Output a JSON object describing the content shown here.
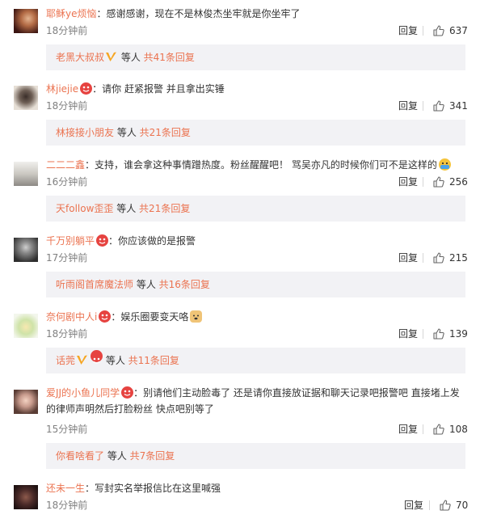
{
  "comments": [
    {
      "username": "耶稣ye烦恼",
      "separator": "：",
      "text": "感谢感谢，现在不是林俊杰坐牢就是你坐牢了",
      "time": "18分钟前",
      "reply_label": "回复",
      "likes": "637",
      "sub": {
        "lead": "老黑大叔叔",
        "mid": " 等人 ",
        "count": "共41条回复"
      }
    },
    {
      "username": "林jiejie",
      "separator": "：",
      "text": "请你 赶紧报警 并且拿出实锤",
      "time": "18分钟前",
      "reply_label": "回复",
      "likes": "341",
      "sub": {
        "lead": "林接接小朋友",
        "mid": " 等人 ",
        "count": "共21条回复"
      }
    },
    {
      "username": "二二二鑫",
      "separator": "：",
      "text": "支持，谁会拿这种事情蹭热度。粉丝醒醒吧！ 骂吴亦凡的时候你们可不是这样的",
      "time": "16分钟前",
      "reply_label": "回复",
      "likes": "256",
      "sub": {
        "lead": "天follow歪歪",
        "mid": " 等人 ",
        "count": "共21条回复"
      }
    },
    {
      "username": "千万别躺平",
      "separator": "：",
      "text": "你应该做的是报警",
      "time": "17分钟前",
      "reply_label": "回复",
      "likes": "215",
      "sub": {
        "lead": "听雨阁首席魔法师",
        "mid": " 等人 ",
        "count": "共16条回复"
      }
    },
    {
      "username": "奈何剧中人i",
      "separator": "：",
      "text": "娱乐圈要变天咯",
      "time": "18分钟前",
      "reply_label": "回复",
      "likes": "139",
      "sub": {
        "lead": "话莞",
        "mid": " 等人 ",
        "count": "共11条回复"
      }
    },
    {
      "username": "爱JJ的小鱼儿同学",
      "separator": "：",
      "text": "别请他们主动脸毒了 还是请你直接放证据和聊天记录吧报警吧  直接堵上发的律师声明然后打脸粉丝  快点吧别等了",
      "time": "15分钟前",
      "reply_label": "回复",
      "likes": "108",
      "sub": {
        "lead": "你看啥看了",
        "mid": " 等人 ",
        "count": "共7条回复"
      }
    },
    {
      "username": "还未一生",
      "separator": "：",
      "text": "写封实名举报信比在这里喊强",
      "time": "18分钟前",
      "reply_label": "回复",
      "likes": "70"
    }
  ],
  "colors": {
    "username": "#eb7350",
    "sub_bg": "#f2f2f5",
    "vip_gold": "#f6a623",
    "emoji_red": "#e64340"
  }
}
